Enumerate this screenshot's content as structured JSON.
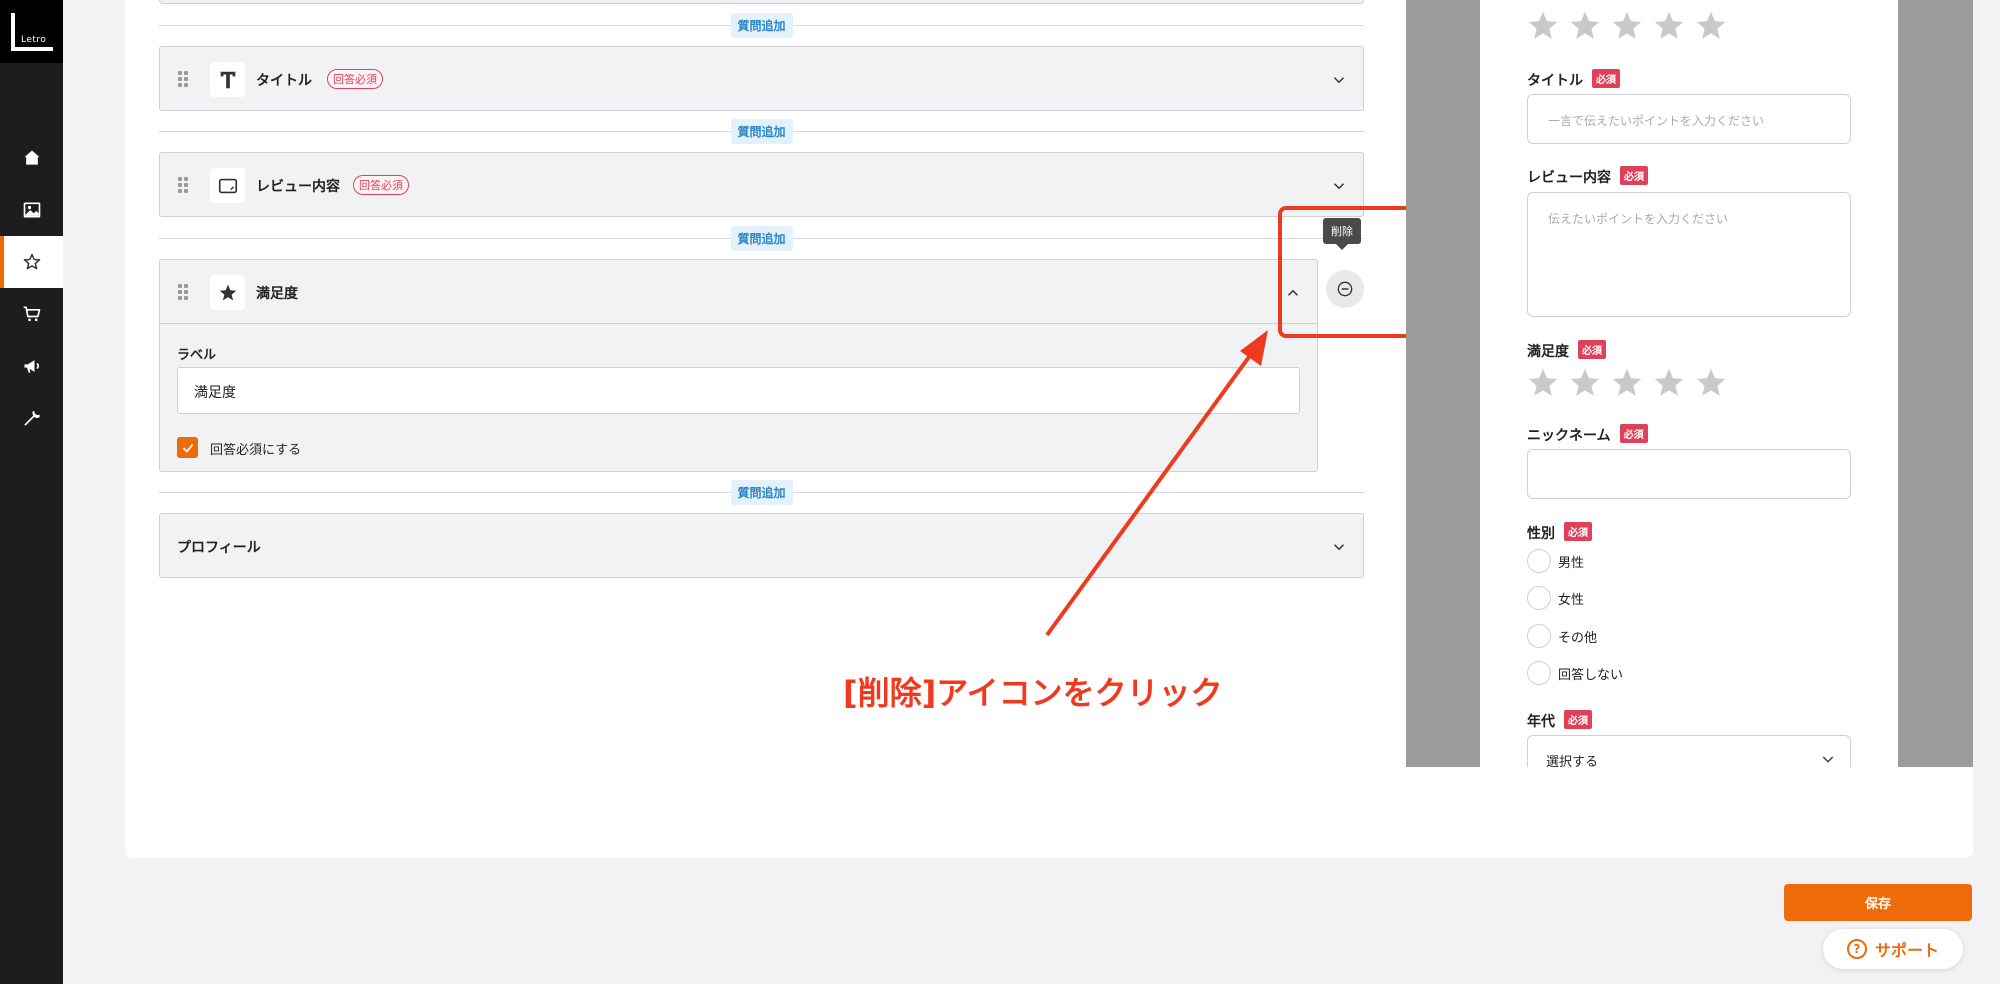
{
  "logo": {
    "text": "Letro"
  },
  "sidebar": {
    "items": [
      {
        "name": "home",
        "icon": "home-icon"
      },
      {
        "name": "images",
        "icon": "image-icon"
      },
      {
        "name": "reviews",
        "icon": "star-icon",
        "active": true
      },
      {
        "name": "cart",
        "icon": "cart-icon"
      },
      {
        "name": "campaign",
        "icon": "megaphone-icon"
      },
      {
        "name": "settings",
        "icon": "wrench-icon"
      }
    ]
  },
  "editor": {
    "add_question_label": "質問追加",
    "questions": [
      {
        "label": "タイトル",
        "required_badge": "回答必須",
        "icon": "text-icon",
        "expanded": false
      },
      {
        "label": "レビュー内容",
        "required_badge": "回答必須",
        "icon": "textarea-icon",
        "expanded": false
      },
      {
        "label": "満足度",
        "icon": "star-icon",
        "expanded": true,
        "field_label": "ラベル",
        "field_value": "満足度",
        "required_checkbox_label": "回答必須にする",
        "required_checked": true
      },
      {
        "label": "プロフィール",
        "expanded": false
      }
    ],
    "delete_tooltip": "削除"
  },
  "annotation": {
    "text": "[削除]アイコンをクリック",
    "color": "#f03a1f"
  },
  "preview": {
    "required_badge": "必須",
    "title_label": "タイトル",
    "title_placeholder": "一言で伝えたいポイントを入力ください",
    "content_label": "レビュー内容",
    "content_placeholder": "伝えたいポイントを入力ください",
    "satisfaction_label": "満足度",
    "nickname_label": "ニックネーム",
    "gender_label": "性別",
    "gender_options": [
      "男性",
      "女性",
      "その他",
      "回答しない"
    ],
    "age_label": "年代",
    "age_select_value": "選択する"
  },
  "footer": {
    "save_label": "保存",
    "support_label": "サポート"
  },
  "colors": {
    "accent": "#ee6b0a",
    "required": "#e0415a",
    "link": "#2a86c8"
  }
}
